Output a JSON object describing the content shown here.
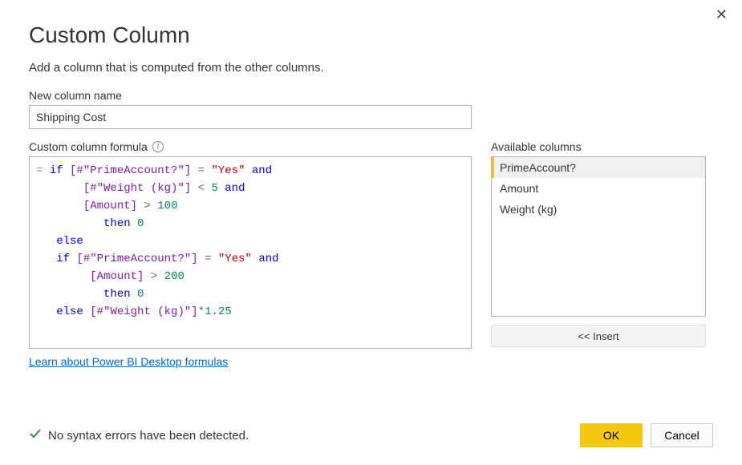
{
  "dialog": {
    "title": "Custom Column",
    "subtitle": "Add a column that is computed from the other columns."
  },
  "name_field": {
    "label": "New column name",
    "value": "Shipping Cost"
  },
  "formula_field": {
    "label": "Custom column formula",
    "tokens": [
      [
        [
          "eq",
          "= "
        ],
        [
          "kw",
          "if"
        ],
        [
          "plain",
          " "
        ],
        [
          "col",
          "[#\"PrimeAccount?\"]"
        ],
        [
          "plain",
          " "
        ],
        [
          "op",
          "="
        ],
        [
          "plain",
          " "
        ],
        [
          "str",
          "\"Yes\""
        ],
        [
          "plain",
          " "
        ],
        [
          "kw",
          "and"
        ]
      ],
      [
        [
          "plain",
          "    "
        ],
        [
          "col",
          "[#\"Weight (kg)\"]"
        ],
        [
          "plain",
          " "
        ],
        [
          "op",
          "<"
        ],
        [
          "plain",
          " "
        ],
        [
          "num",
          "5"
        ],
        [
          "plain",
          " "
        ],
        [
          "kw",
          "and"
        ]
      ],
      [
        [
          "plain",
          "    "
        ],
        [
          "col",
          "[Amount]"
        ],
        [
          "plain",
          " "
        ],
        [
          "op",
          ">"
        ],
        [
          "plain",
          " "
        ],
        [
          "num",
          "100"
        ]
      ],
      [
        [
          "plain",
          "       "
        ],
        [
          "kw",
          "then"
        ],
        [
          "plain",
          " "
        ],
        [
          "num",
          "0"
        ]
      ],
      [
        [
          "kw",
          "else"
        ]
      ],
      [
        [
          "kw",
          "if"
        ],
        [
          "plain",
          " "
        ],
        [
          "col",
          "[#\"PrimeAccount?\"]"
        ],
        [
          "plain",
          " "
        ],
        [
          "op",
          "="
        ],
        [
          "plain",
          " "
        ],
        [
          "str",
          "\"Yes\""
        ],
        [
          "plain",
          " "
        ],
        [
          "kw",
          "and"
        ]
      ],
      [
        [
          "plain",
          "     "
        ],
        [
          "col",
          "[Amount]"
        ],
        [
          "plain",
          " "
        ],
        [
          "op",
          ">"
        ],
        [
          "plain",
          " "
        ],
        [
          "num",
          "200"
        ]
      ],
      [
        [
          "plain",
          "       "
        ],
        [
          "kw",
          "then"
        ],
        [
          "plain",
          " "
        ],
        [
          "num",
          "0"
        ]
      ],
      [
        [
          "kw",
          "else"
        ],
        [
          "plain",
          " "
        ],
        [
          "col",
          "[#\"Weight (kg)\"]"
        ],
        [
          "op",
          "*"
        ],
        [
          "num",
          "1.25"
        ]
      ]
    ]
  },
  "available": {
    "label": "Available columns",
    "items": [
      "PrimeAccount?",
      "Amount",
      "Weight (kg)"
    ],
    "selected": 0,
    "insert_label": "<< Insert"
  },
  "learn_link": "Learn about Power BI Desktop formulas",
  "status": {
    "text": "No syntax errors have been detected."
  },
  "buttons": {
    "ok": "OK",
    "cancel": "Cancel"
  }
}
